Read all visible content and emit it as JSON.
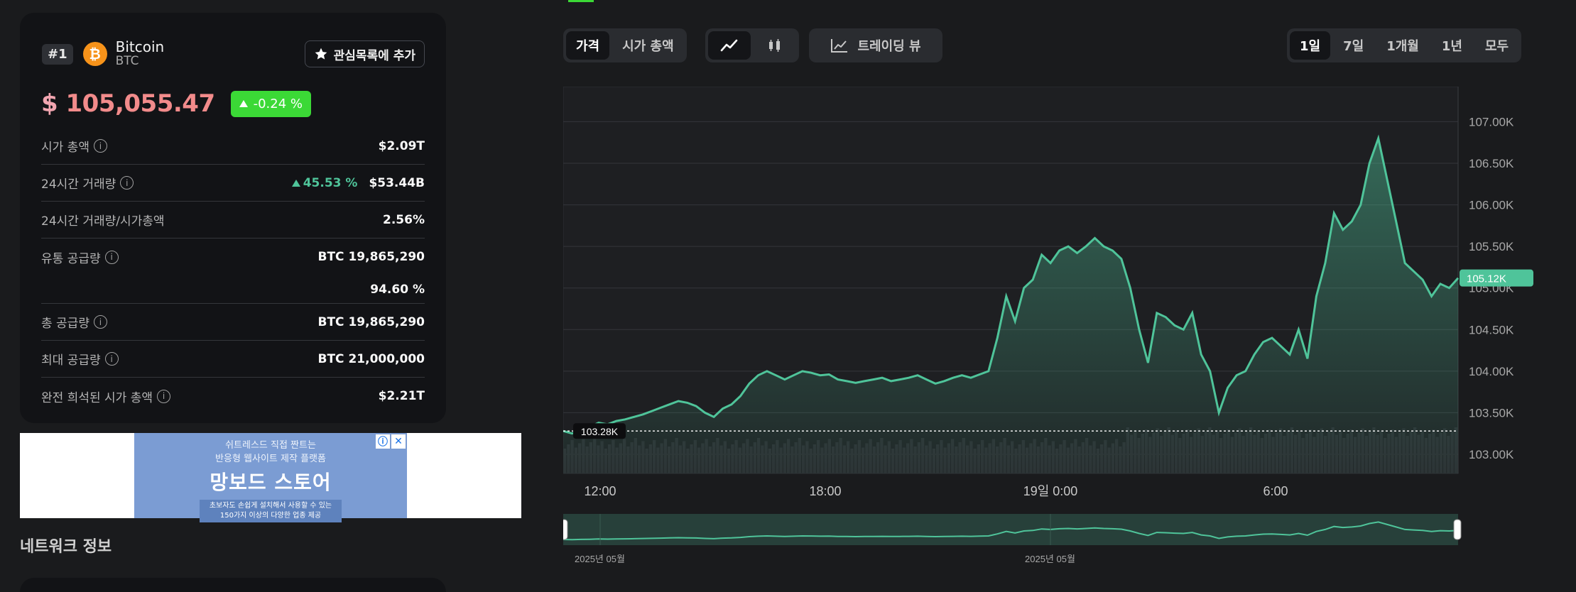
{
  "coin": {
    "rank": "#1",
    "icon": "bitcoin-icon",
    "name": "Bitcoin",
    "symbol": "BTC",
    "watch_label": "관심목록에 추가",
    "price_currency": "$",
    "price": "105,055.47",
    "change": "-0.24 %"
  },
  "stats": {
    "market_cap": {
      "label": "시가 총액",
      "value": "$2.09T"
    },
    "volume_24h": {
      "label": "24시간 거래량",
      "change": "45.53 %",
      "value": "$53.44B"
    },
    "vol_mcap": {
      "label": "24시간 거래량/시가총액",
      "value": "2.56%"
    },
    "circulating": {
      "label": "유통 공급량",
      "value": "BTC 19,865,290",
      "percent": "94.60 %"
    },
    "total_supply": {
      "label": "총 공급량",
      "value": "BTC 19,865,290"
    },
    "max_supply": {
      "label": "최대 공급량",
      "value": "BTC 21,000,000"
    },
    "fdv": {
      "label": "완전 희석된 시가 총액",
      "value": "$2.21T"
    }
  },
  "ad": {
    "line1": "쉬트레스드 직접 짠트는",
    "line2": "반응형 웹사이트 제작 플랫폼",
    "title": "망보드 스토어",
    "desc1": "초보자도 손쉽게 설치해서 사용할 수 있는",
    "desc2": "150가지 이상의 다양한 업종 제공"
  },
  "network_title": "네트워크 정보",
  "toolbar": {
    "metric_tabs": [
      "가격",
      "시가 총액"
    ],
    "tradingview_label": "트레이딩 뷰",
    "range_tabs": [
      "1일",
      "7일",
      "1개월",
      "1년",
      "모두"
    ]
  },
  "chart_data": {
    "type": "area",
    "y_ticks": [
      "107.00K",
      "106.50K",
      "106.00K",
      "105.50K",
      "105.00K",
      "104.50K",
      "104.00K",
      "103.50K",
      "103.00K"
    ],
    "ylim": [
      103000,
      107000
    ],
    "x_ticks": [
      "12:00",
      "18:00",
      "19일 0:00",
      "6:00"
    ],
    "current_label": "105.12K",
    "start_label": "103.28K",
    "navigator_labels": [
      "2025년 05월",
      "2025년 05월"
    ],
    "accent": "#4fc49a",
    "values": [
      103280,
      103250,
      103300,
      103330,
      103380,
      103360,
      103400,
      103420,
      103450,
      103480,
      103520,
      103560,
      103600,
      103640,
      103620,
      103580,
      103500,
      103450,
      103550,
      103600,
      103700,
      103850,
      103950,
      104000,
      103950,
      103900,
      103950,
      104000,
      103980,
      103950,
      103960,
      103900,
      103880,
      103860,
      103880,
      103900,
      103920,
      103880,
      103900,
      103920,
      103950,
      103900,
      103850,
      103880,
      103920,
      103950,
      103920,
      103960,
      104000,
      104400,
      104900,
      104600,
      105000,
      105100,
      105400,
      105300,
      105450,
      105500,
      105420,
      105500,
      105600,
      105500,
      105450,
      105350,
      105000,
      104500,
      104100,
      104700,
      104650,
      104550,
      104500,
      104700,
      104200,
      104000,
      103500,
      103800,
      103950,
      104000,
      104200,
      104350,
      104400,
      104300,
      104200,
      104500,
      104150,
      104900,
      105300,
      105900,
      105700,
      105800,
      106000,
      106500,
      106800,
      106300,
      105800,
      105300,
      105200,
      105100,
      104900,
      105050,
      105000,
      105120
    ]
  },
  "colors": {
    "background": "#1a1b1d",
    "card": "#121316",
    "up_green": "#3bd936",
    "price_red": "#f28b8b",
    "line": "#4fc49a"
  }
}
